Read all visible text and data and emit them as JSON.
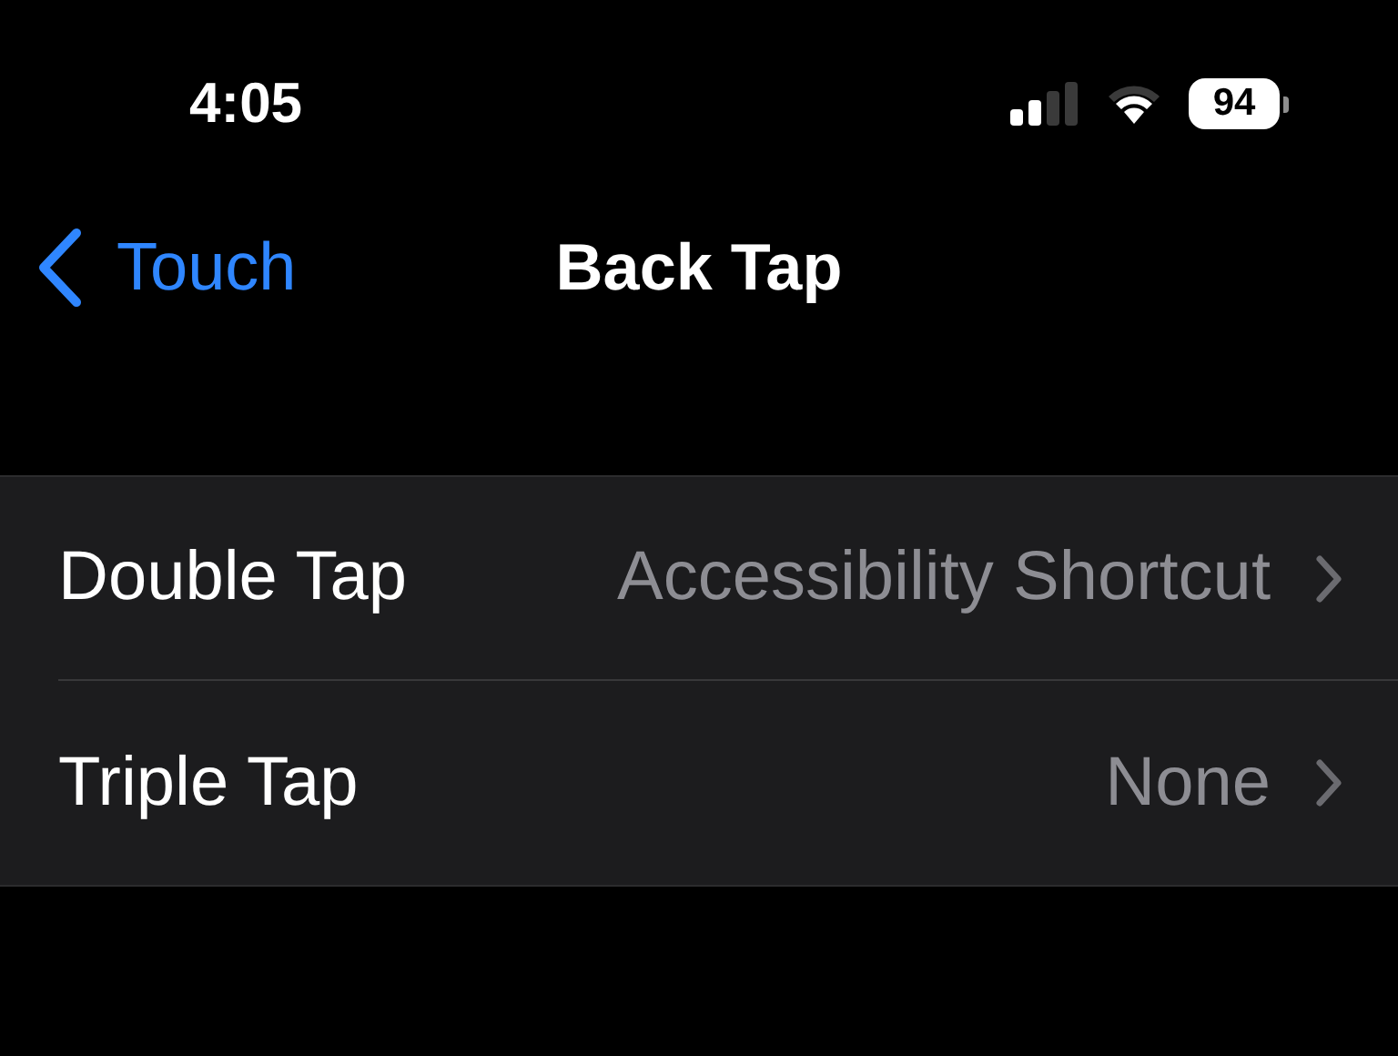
{
  "status_bar": {
    "time": "4:05",
    "battery": "94"
  },
  "nav": {
    "back": "Touch",
    "title": "Back Tap"
  },
  "rows": [
    {
      "label": "Double Tap",
      "value": "Accessibility Shortcut"
    },
    {
      "label": "Triple Tap",
      "value": "None"
    }
  ]
}
